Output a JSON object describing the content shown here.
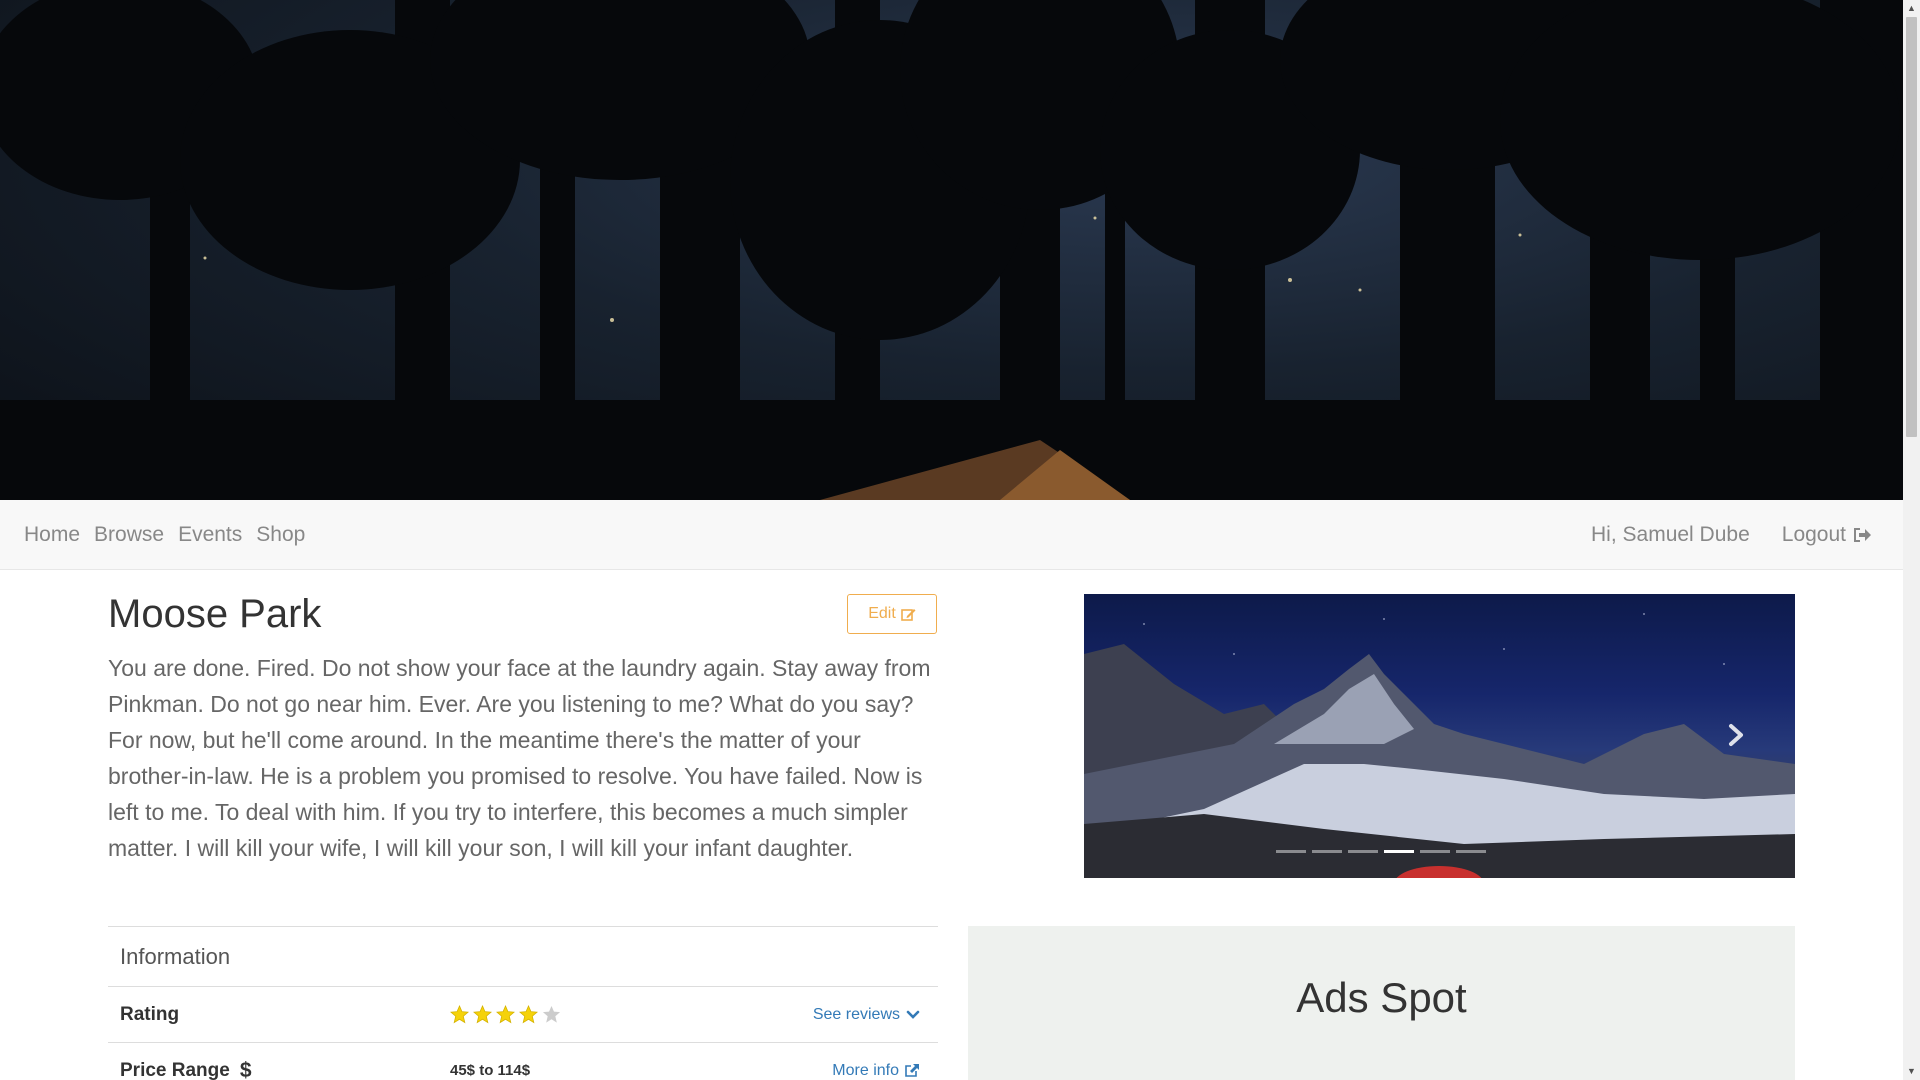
{
  "navbar": {
    "links": [
      "Home",
      "Browse",
      "Events",
      "Shop"
    ],
    "greeting": "Hi, Samuel Dube",
    "logout_label": "Logout",
    "logout_icon": "sign-out-icon"
  },
  "park": {
    "title": "Moose Park",
    "edit_label": "Edit",
    "edit_icon": "edit-icon",
    "description": "You are done. Fired. Do not show your face at the laundry again. Stay away from Pinkman. Do not go near him. Ever. Are you listening to me? What do you say? For now, but he'll come around. In the meantime there's the matter of your brother-in-law. He is a problem you promised to resolve. You have failed. Now is left to me. To deal with him. If you try to interfere, this becomes a much simpler matter. I will kill your wife, I will kill your son, I will kill your infant daughter."
  },
  "carousel": {
    "slide_count": 6,
    "active_index": 3,
    "next_icon": "chevron-right-icon"
  },
  "information": {
    "header": "Information",
    "rating": {
      "label": "Rating",
      "stars_filled": 4,
      "stars_total": 5,
      "link_label": "See reviews",
      "link_icon": "chevron-down-icon"
    },
    "price": {
      "label": "Price Range",
      "label_icon": "dollar-icon",
      "value": "45$ to 114$",
      "link_label": "More info",
      "link_icon": "external-link-icon"
    }
  },
  "ads": {
    "title": "Ads Spot"
  },
  "colors": {
    "star_filled": "#f5d20a",
    "star_empty": "#cccccc",
    "edit_accent": "#f0ad4e",
    "link_blue": "#337ab7"
  }
}
